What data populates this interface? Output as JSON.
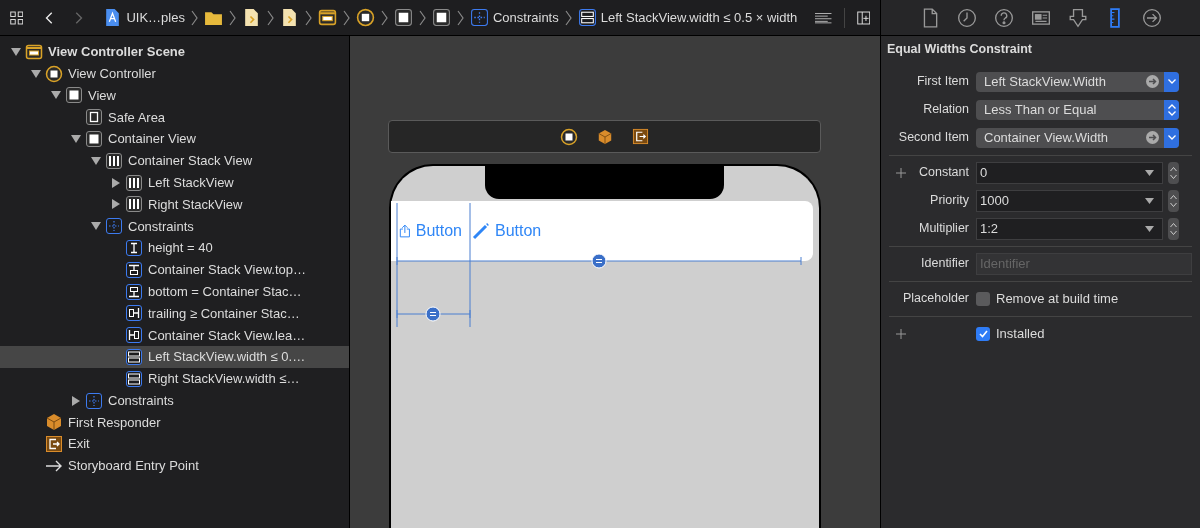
{
  "toolbar": {
    "back_enabled": true,
    "forward_enabled": false
  },
  "breadcrumb": [
    {
      "kind": "project",
      "label": "UIK…ples"
    },
    {
      "kind": "folder"
    },
    {
      "kind": "storyboard"
    },
    {
      "kind": "storyboard"
    },
    {
      "kind": "scene"
    },
    {
      "kind": "controller"
    },
    {
      "kind": "view"
    },
    {
      "kind": "view"
    },
    {
      "kind": "constraints",
      "label": "Constraints"
    },
    {
      "kind": "width",
      "label": "Left StackView.width ≤ 0.5 × width"
    }
  ],
  "inspector_tabs": [
    {
      "kind": "file",
      "selected": false
    },
    {
      "kind": "history",
      "selected": false
    },
    {
      "kind": "help",
      "selected": false
    },
    {
      "kind": "identity",
      "selected": false
    },
    {
      "kind": "attributes",
      "selected": false
    },
    {
      "kind": "size",
      "selected": true
    },
    {
      "kind": "connections",
      "selected": false
    }
  ],
  "outline": [
    {
      "label": "View Controller Scene",
      "kind": "scene",
      "expanded": true,
      "selected": false,
      "children": [
        {
          "label": "View Controller",
          "kind": "controller",
          "expanded": true,
          "selected": false,
          "children": [
            {
              "label": "View",
              "kind": "view",
              "expanded": true,
              "selected": false,
              "children": [
                {
                  "label": "Safe Area",
                  "kind": "safe-area",
                  "selected": false
                },
                {
                  "label": "Container View",
                  "kind": "view",
                  "expanded": true,
                  "selected": false,
                  "children": [
                    {
                      "label": "Container Stack View",
                      "kind": "stack",
                      "expanded": true,
                      "selected": false,
                      "children": [
                        {
                          "label": "Left StackView",
                          "kind": "stack",
                          "expanded": false,
                          "selected": false
                        },
                        {
                          "label": "Right StackView",
                          "kind": "stack",
                          "expanded": false,
                          "selected": false
                        }
                      ]
                    },
                    {
                      "label": "Constraints",
                      "kind": "constraints",
                      "expanded": true,
                      "selected": false,
                      "children": [
                        {
                          "label": "height = 40",
                          "kind": "height",
                          "selected": false
                        },
                        {
                          "label": "Container Stack View.top…",
                          "kind": "top",
                          "selected": false
                        },
                        {
                          "label": "bottom = Container Stac…",
                          "kind": "bottom",
                          "selected": false
                        },
                        {
                          "label": "trailing ≥ Container Stac…",
                          "kind": "trailing",
                          "selected": false
                        },
                        {
                          "label": "Container Stack View.lea…",
                          "kind": "leading",
                          "selected": false
                        },
                        {
                          "label": "Left StackView.width ≤ 0.…",
                          "kind": "width",
                          "selected": true
                        },
                        {
                          "label": "Right StackView.width ≤…",
                          "kind": "width",
                          "selected": false
                        }
                      ]
                    }
                  ]
                },
                {
                  "label": "Constraints",
                  "kind": "constraints",
                  "expanded": false,
                  "selected": false
                }
              ]
            }
          ]
        },
        {
          "label": "First Responder",
          "kind": "responder",
          "selected": false
        },
        {
          "label": "Exit",
          "kind": "exit",
          "selected": false
        },
        {
          "label": "Storyboard Entry Point",
          "kind": "entry",
          "selected": false
        }
      ]
    }
  ],
  "canvas": {
    "buttons": [
      {
        "kind": "share",
        "label": "Button"
      },
      {
        "kind": "pencil",
        "label": "Button"
      }
    ]
  },
  "inspector": {
    "title": "Equal Widths Constraint",
    "sections": [
      [
        {
          "kind": "item",
          "label": "First Item",
          "value": "Left StackView.Width"
        },
        {
          "kind": "popup",
          "label": "Relation",
          "value": "Less Than or Equal"
        },
        {
          "kind": "item",
          "label": "Second Item",
          "value": "Container View.Width"
        }
      ],
      [
        {
          "kind": "combo",
          "label": "Constant",
          "value": "0",
          "plus": true
        },
        {
          "kind": "combo",
          "label": "Priority",
          "value": "1000"
        },
        {
          "kind": "combo",
          "label": "Multiplier",
          "value": "1:2"
        }
      ],
      [
        {
          "kind": "text",
          "label": "Identifier",
          "placeholder": "Identifier"
        }
      ],
      [
        {
          "kind": "checkbox",
          "label": "Placeholder",
          "text": "Remove at build time",
          "checked": false
        }
      ],
      [
        {
          "kind": "checkbox",
          "text": "Installed",
          "checked": true,
          "plus": true
        }
      ]
    ]
  }
}
